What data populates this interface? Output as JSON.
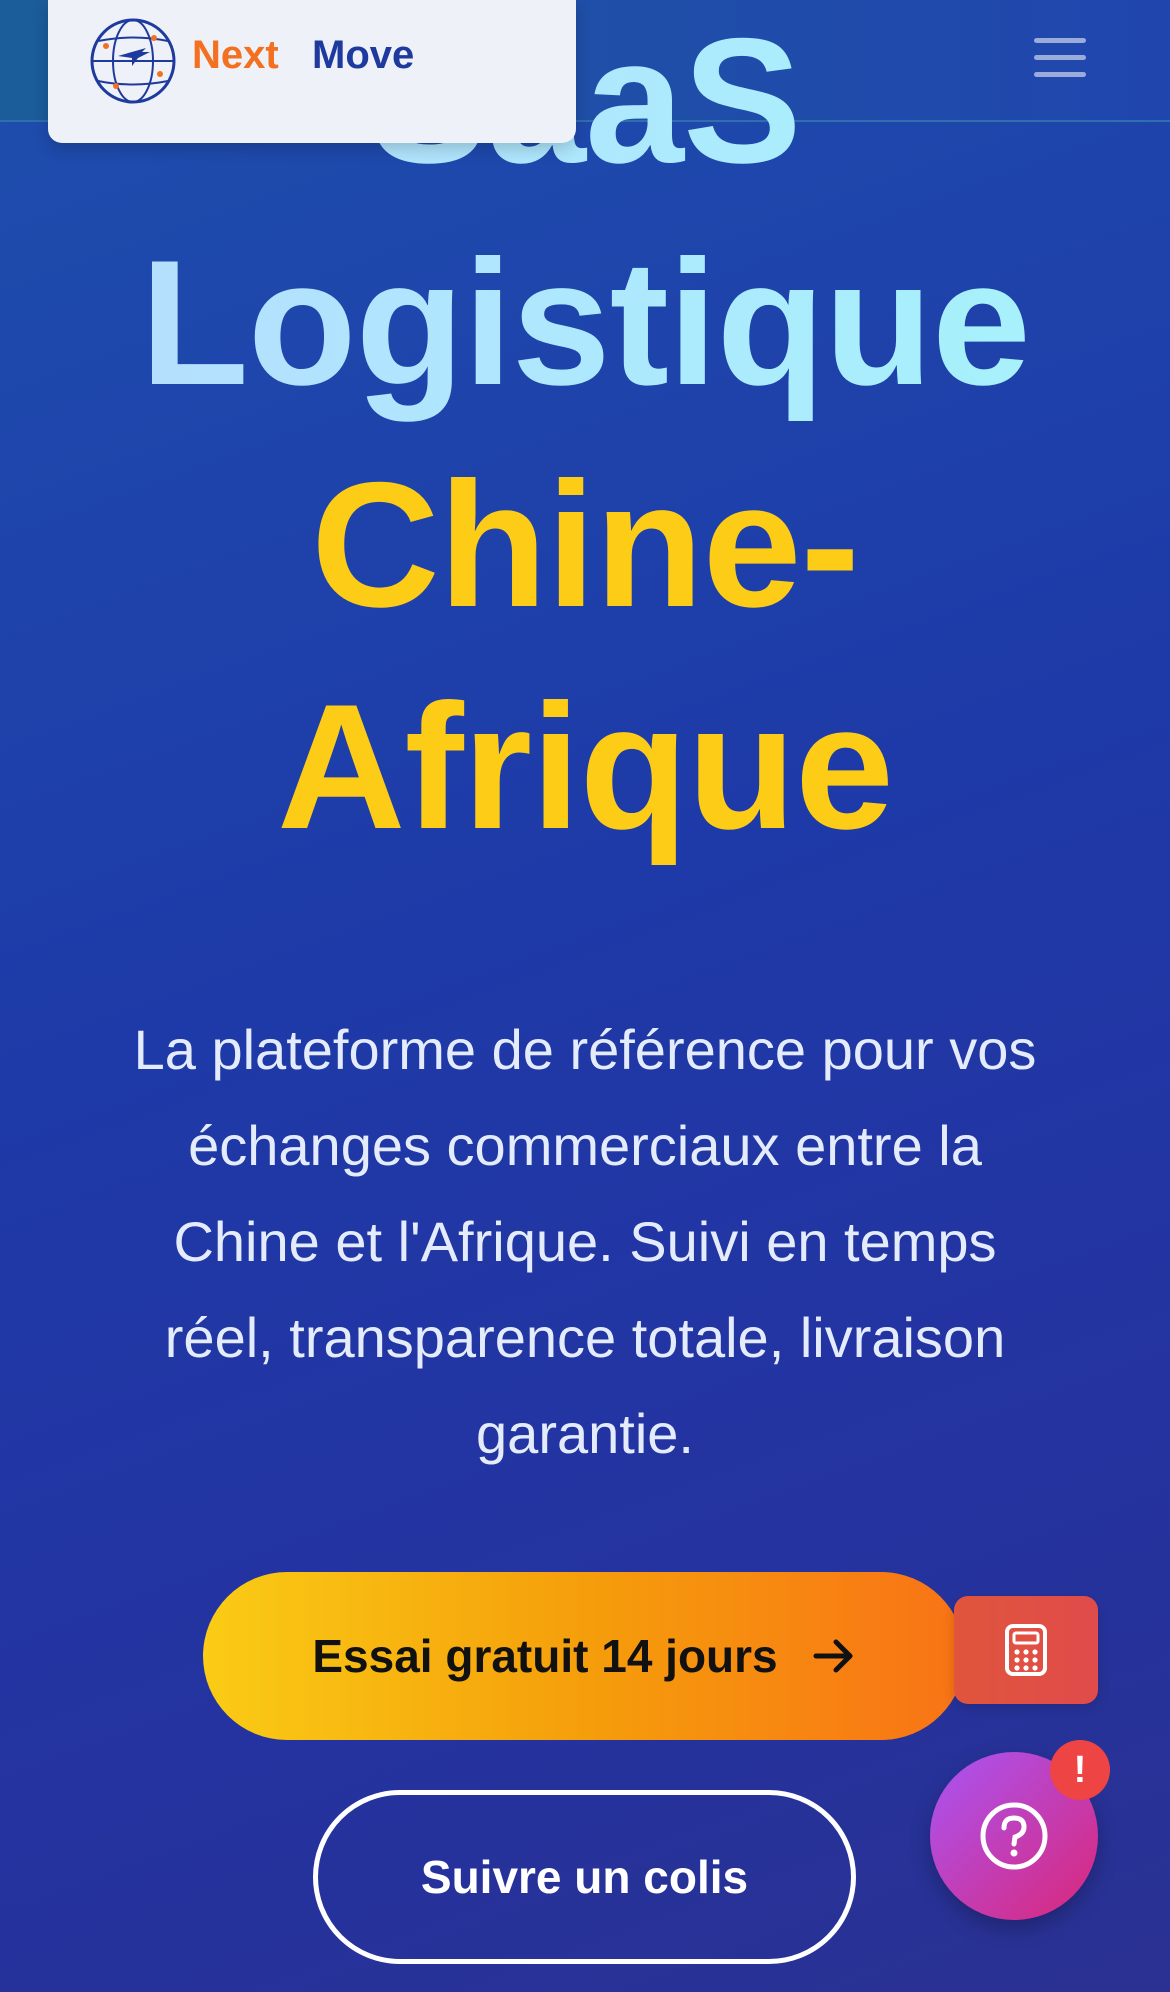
{
  "header": {
    "brand_part1": "Next",
    "brand_part2": "Move",
    "logo_icon": "globe-plane-icon",
    "menu_icon": "hamburger-menu-icon"
  },
  "hero": {
    "title_lines": [
      "SaaS",
      "Logistique",
      "Chine-",
      "Afrique"
    ],
    "subtitle_lines": [
      "La plateforme de référence pour vos",
      "échanges commerciaux entre la",
      "Chine et l'Afrique. Suivi en temps",
      "réel, transparence totale, livraison",
      "garantie."
    ]
  },
  "actions": {
    "primary_label": "Essai gratuit 14 jours",
    "primary_icon": "arrow-right-icon",
    "secondary_label": "Suivre un colis",
    "calculator_icon": "calculator-icon"
  },
  "help": {
    "icon": "question-circle-icon",
    "badge": "!"
  },
  "colors": {
    "brand_orange": "#f37021",
    "brand_blue": "#1f3a9e",
    "title_cyan": "#a5f3fc",
    "title_yellow": "#fccc16",
    "cta_gradient_start": "#facc15",
    "cta_gradient_end": "#f97316",
    "badge_red": "#ef4444"
  }
}
